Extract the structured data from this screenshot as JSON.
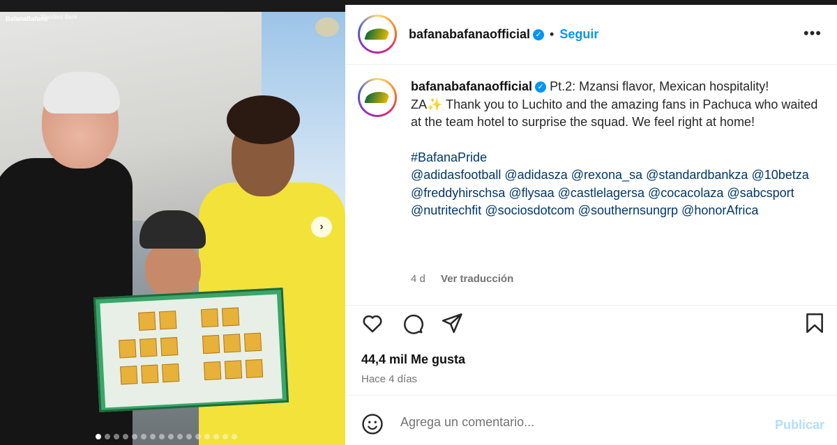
{
  "header": {
    "username": "bafanabafanaofficial",
    "verified_glyph": "✓",
    "separator": "•",
    "follow_label": "Seguir",
    "more_label": "•••"
  },
  "media": {
    "carousel_total": 16,
    "carousel_active": 1,
    "next_glyph": "›",
    "brand_logo": "BafanaBafana",
    "brand_bank": "Standard Bank"
  },
  "caption": {
    "username": "bafanabafanaofficial",
    "line1": "Pt.2: Mzansi flavor, Mexican hospitality!",
    "line2": "ZA✨ Thank you to Luchito and the amazing fans in Pachuca who waited at the team hotel to surprise the squad. We feel right at home!",
    "hashtag": "#BafanaPride",
    "mentions": [
      "@adidasfootball",
      "@adidasza",
      "@rexona_sa",
      "@standardbankza",
      "@10betza",
      "@freddyhirschsa",
      "@flysaa",
      "@castlelagersa",
      "@cocacolaza",
      "@sabcsport",
      "@nutritechfit",
      "@sociosdotcom",
      "@southernsungrp",
      "@honorAfrica"
    ],
    "time_ago": "4 d",
    "translate_label": "Ver traducción"
  },
  "actions": {
    "icons": [
      "heart-icon",
      "comment-icon",
      "share-icon",
      "bookmark-icon"
    ]
  },
  "stats": {
    "likes": "44,4 mil Me gusta",
    "posted": "Hace 4 días"
  },
  "comment": {
    "placeholder": "Agrega un comentario...",
    "post_label": "Publicar"
  },
  "colors": {
    "link": "#00376b",
    "accent": "#0095f6",
    "muted": "#737373",
    "post_disabled": "#b2dffc"
  }
}
